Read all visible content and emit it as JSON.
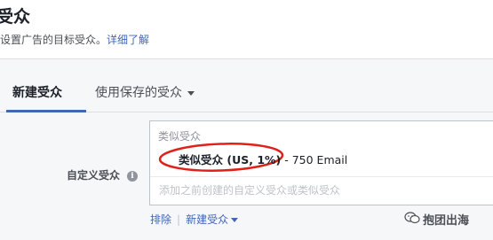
{
  "header": {
    "title": "受众",
    "subtitle": "设置广告的目标受众。",
    "learn_more": "详细了解"
  },
  "tabs": {
    "new_audience": "新建受众",
    "saved_audience": "使用保存的受众"
  },
  "custom_audience": {
    "label": "自定义受众",
    "info_icon_glyph": "i",
    "group_label": "类似受众",
    "selected": {
      "name": "类似受众 (US, 1%)",
      "detail": " - 750 Email"
    },
    "search_placeholder": "添加之前创建的自定义受众或类似受众"
  },
  "actions": {
    "exclude": "排除",
    "create_new": "新建受众"
  },
  "watermark": {
    "text": "抱团出海"
  },
  "colors": {
    "link": "#4267b2",
    "highlight": "#e0201a"
  }
}
